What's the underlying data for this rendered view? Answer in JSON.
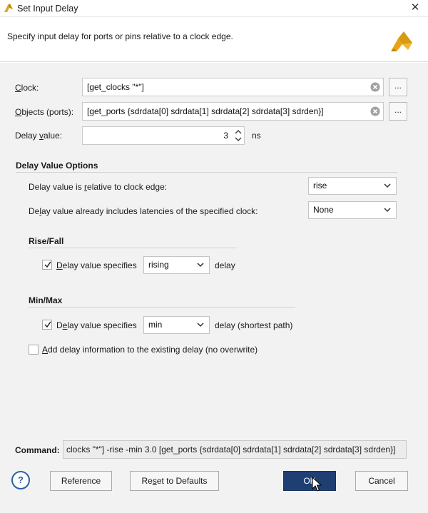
{
  "window": {
    "title": "Set Input Delay",
    "close_symbol": "✕"
  },
  "header": {
    "description": "Specify input delay for ports or pins relative to a clock edge."
  },
  "form": {
    "clock": {
      "label_accel": "C",
      "label_rest": "lock:",
      "value": "[get_clocks \"*\"]"
    },
    "objects": {
      "label_accel": "O",
      "label_rest": "bjects (ports):",
      "value": "[get_ports {sdrdata[0] sdrdata[1] sdrdata[2] sdrdata[3] sdrden}]"
    },
    "delay_value": {
      "label_pre": "Delay ",
      "label_accel": "v",
      "label_rest": "alue:",
      "value": "3",
      "unit": "ns"
    },
    "browse_label": "..."
  },
  "delay_value_options": {
    "title": "Delay Value Options",
    "relative": {
      "label_pre": "Delay value is ",
      "label_accel": "r",
      "label_rest": "elative to clock edge:",
      "value": "rise"
    },
    "latencies": {
      "label_pre": "De",
      "label_accel": "l",
      "label_rest": "ay value already includes latencies of the specified clock:",
      "value": "None"
    }
  },
  "rise_fall": {
    "title": "Rise/Fall",
    "checked": true,
    "label_accel": "D",
    "label_rest": "elay value specifies",
    "select_value": "rising",
    "suffix": "delay"
  },
  "min_max": {
    "title": "Min/Max",
    "checked": true,
    "label_pre": "D",
    "label_accel": "e",
    "label_rest": "lay value specifies",
    "select_value": "min",
    "suffix": "delay (shortest path)"
  },
  "add_delay": {
    "checked": false,
    "label_accel": "A",
    "label_rest": "dd delay information to the existing delay (no overwrite)"
  },
  "command": {
    "label": "Command:",
    "value": "clocks \"*\"] -rise -min 3.0 [get_ports {sdrdata[0] sdrdata[1] sdrdata[2] sdrdata[3] sdrden}]"
  },
  "buttons": {
    "help": "?",
    "reference": "Reference",
    "reset_pre": "Re",
    "reset_accel": "s",
    "reset_rest": "et to Defaults",
    "ok": "OK",
    "cancel": "Cancel"
  },
  "colors": {
    "primary_button": "#1f3f73",
    "help_accent": "#2d5fa8",
    "panel_bg": "#f2f2f2"
  },
  "icons": [
    "vivado-app-icon",
    "close-icon",
    "vivado-logo-icon",
    "clear-icon",
    "spin-up-icon",
    "spin-down-icon",
    "chevron-down-icon",
    "checkmark-icon",
    "help-icon",
    "mouse-cursor-icon"
  ]
}
